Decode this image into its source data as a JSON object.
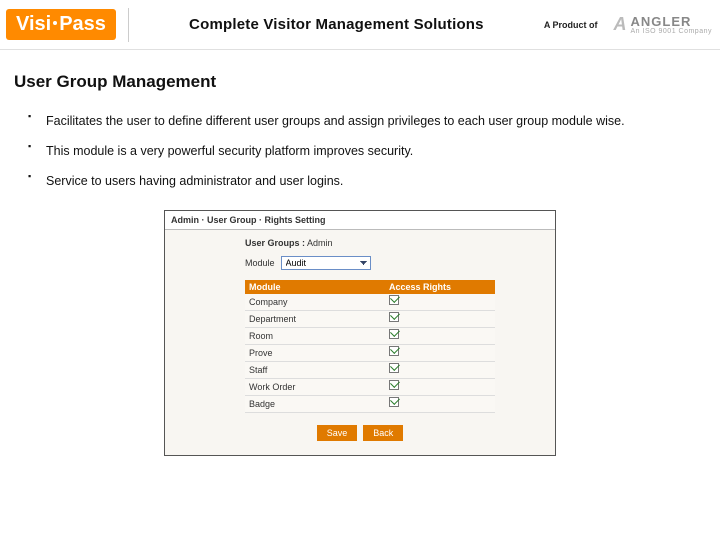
{
  "header": {
    "logo_left": "Visi",
    "logo_right": "Pass",
    "title": "Complete Visitor Management Solutions",
    "product_of": "A Product of",
    "angler": "ANGLER",
    "angler_sub": "An ISO 9001 Company"
  },
  "page_title": "User Group Management",
  "bullets": [
    "Facilitates the user to define different user groups and assign privileges to each user group module wise.",
    "This module is a very powerful security platform improves security.",
    "Service to users having administrator and user logins."
  ],
  "screenshot": {
    "breadcrumb": "Admin · User Group · Rights Setting",
    "group_label": "User Groups :",
    "group_value": "Admin",
    "module_label": "Module",
    "module_value": "Audit",
    "headers": {
      "c1": "Module",
      "c2": "Access Rights"
    },
    "rows": [
      {
        "name": "Company",
        "checked": true
      },
      {
        "name": "Department",
        "checked": true
      },
      {
        "name": "Room",
        "checked": true
      },
      {
        "name": "Prove",
        "checked": true
      },
      {
        "name": "Staff",
        "checked": true
      },
      {
        "name": "Work Order",
        "checked": true
      },
      {
        "name": "Badge",
        "checked": true
      }
    ],
    "buttons": {
      "save": "Save",
      "back": "Back"
    }
  }
}
